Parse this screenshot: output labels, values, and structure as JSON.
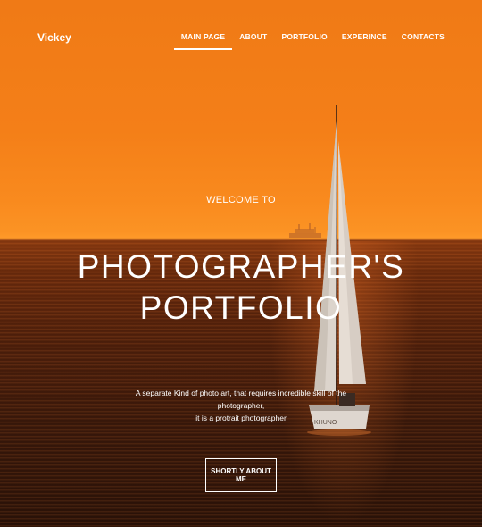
{
  "header": {
    "brand": "Vickey",
    "nav": [
      {
        "label": "MAIN PAGE",
        "active": true
      },
      {
        "label": "ABOUT",
        "active": false
      },
      {
        "label": "PORTFOLIO",
        "active": false
      },
      {
        "label": "EXPERINCE",
        "active": false
      },
      {
        "label": "CONTACTS",
        "active": false
      }
    ]
  },
  "hero": {
    "welcome": "WELCOME TO",
    "title_line1": "PHOTOGRAPHER'S",
    "title_line2": "PORTFOLIO",
    "description_line1": "A separate Kind of photo art, that requires incredible skill of the photographer,",
    "description_line2": "it is a protrait photographer",
    "cta_label": "SHORTLY ABOUT ME",
    "boat_hull_text": "KHUNO"
  },
  "colors": {
    "sky": "#f47f18",
    "sea": "#3a180a",
    "text": "#ffffff"
  }
}
